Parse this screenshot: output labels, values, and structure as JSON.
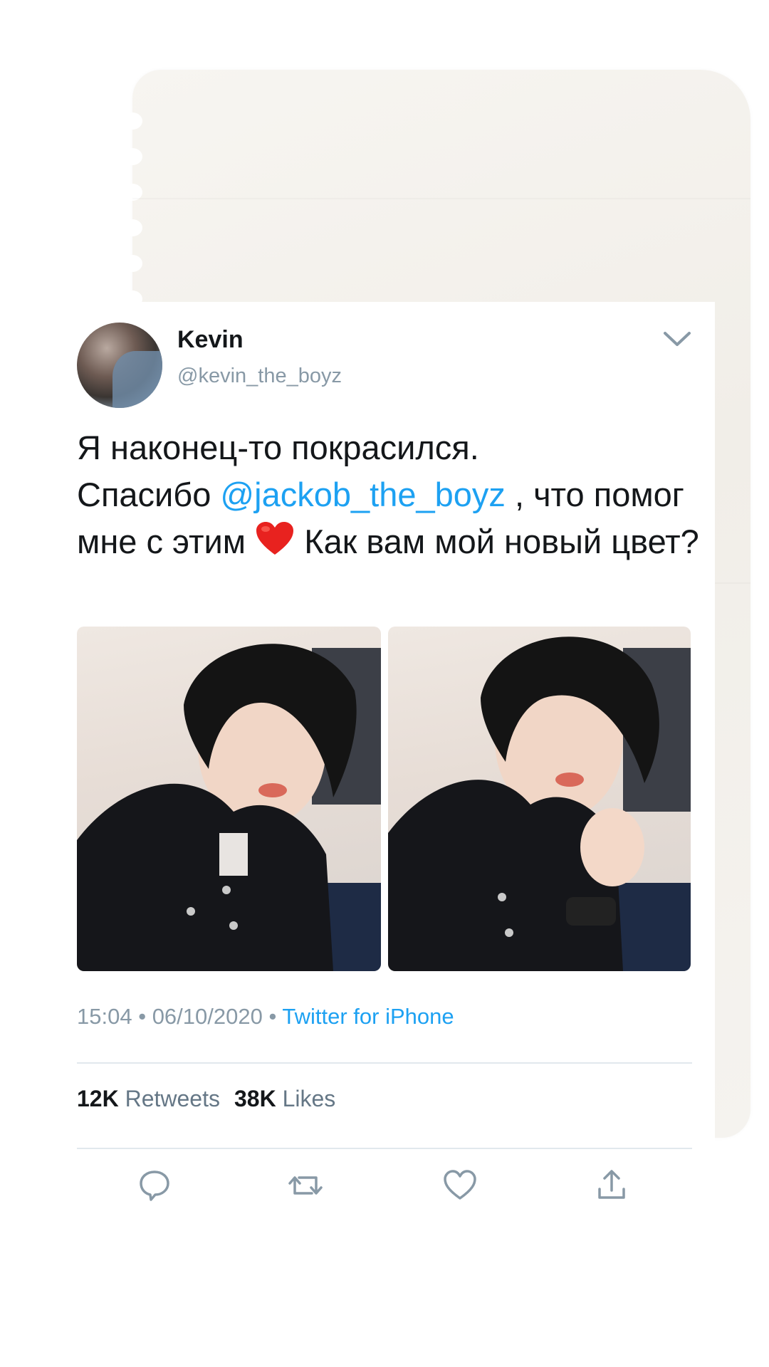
{
  "tweet": {
    "display_name": "Kevin",
    "username": "@kevin_the_boyz",
    "text_line1": "Я наконец-то покрасился.",
    "text_thanks": "Спасибо",
    "mention": "@jackob_the_boyz",
    "text_after_mention": " , что помог мне с этим",
    "text_end": " Как вам мой новый цвет?",
    "emoji": "red-heart",
    "time": "15:04",
    "date": "06/10/2020",
    "source": "Twitter for iPhone",
    "separator": "•"
  },
  "stats": {
    "retweets_count": "12K",
    "retweets_label": "Retweets",
    "likes_count": "38K",
    "likes_label": "Likes"
  },
  "actions": [
    "reply-icon",
    "retweet-icon",
    "like-icon",
    "share-icon"
  ],
  "colors": {
    "link": "#1da1f2",
    "text": "#14171a",
    "secondary": "#8899a6",
    "divider": "#e1e8ed"
  }
}
